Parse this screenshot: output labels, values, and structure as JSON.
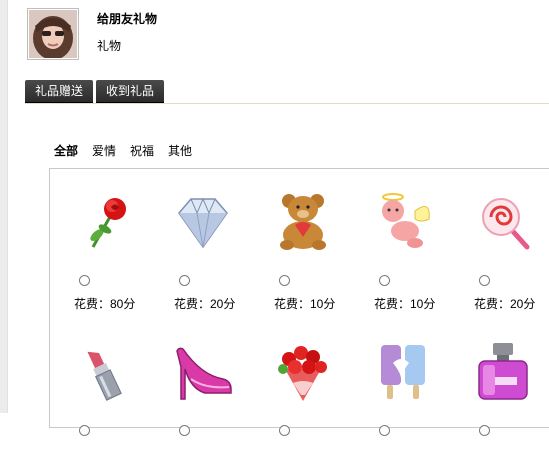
{
  "header": {
    "title": "给朋友礼物",
    "subtitle": "礼物"
  },
  "tabs": [
    {
      "label": "礼品赠送"
    },
    {
      "label": "收到礼品"
    }
  ],
  "filters": [
    {
      "label": "全部"
    },
    {
      "label": "爱情"
    },
    {
      "label": "祝福"
    },
    {
      "label": "其他"
    }
  ],
  "gifts": [
    {
      "icon": "rose-icon",
      "cost": "花费：80分"
    },
    {
      "icon": "diamond-icon",
      "cost": "花费：20分"
    },
    {
      "icon": "teddy-bear-icon",
      "cost": "花费：10分"
    },
    {
      "icon": "cupid-icon",
      "cost": "花费：10分"
    },
    {
      "icon": "lollipop-icon",
      "cost": "花费：20分"
    },
    {
      "icon": "lipstick-icon",
      "cost": ""
    },
    {
      "icon": "high-heel-icon",
      "cost": ""
    },
    {
      "icon": "bouquet-icon",
      "cost": ""
    },
    {
      "icon": "popsicle-icon",
      "cost": ""
    },
    {
      "icon": "perfume-icon",
      "cost": ""
    }
  ]
}
